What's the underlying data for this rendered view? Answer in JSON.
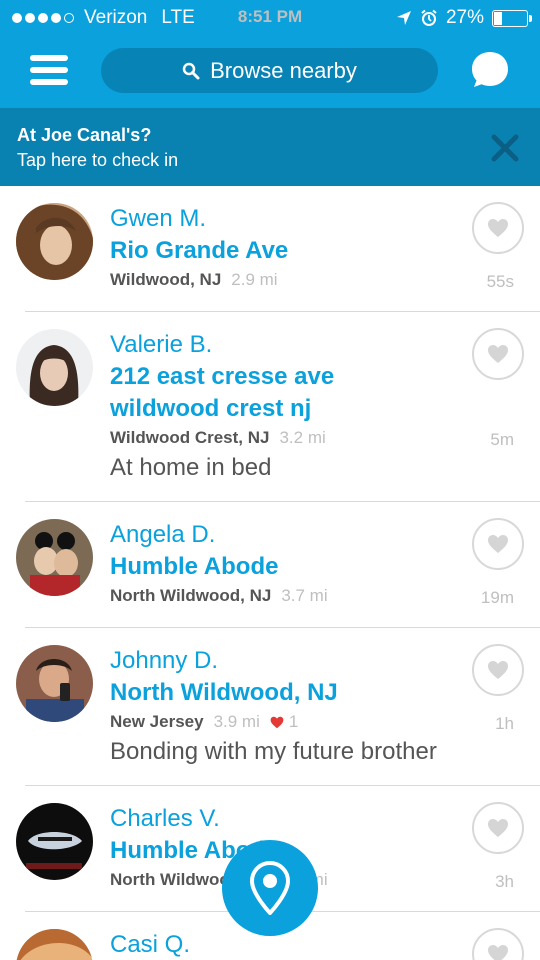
{
  "status_bar": {
    "carrier": "Verizon",
    "network": "LTE",
    "time": "8:51 PM",
    "battery": "27%",
    "battery_level": 0.27
  },
  "header": {
    "search_label": "Browse nearby",
    "icons": [
      "menu-icon",
      "search-icon",
      "chat-icon"
    ]
  },
  "checkin_banner": {
    "title": "At Joe Canal's?",
    "subtitle": "Tap here to check in",
    "close_icon": "close-icon"
  },
  "colors": {
    "accent": "#0aa1dc",
    "banner": "#0a82b1",
    "heart": "#e53935"
  },
  "feed": [
    {
      "name": "Gwen M.",
      "place": [
        "Rio Grande Ave"
      ],
      "city": "Wildwood, NJ",
      "distance": "2.9 mi",
      "time": "55s",
      "status": "",
      "likes": ""
    },
    {
      "name": "Valerie B.",
      "place": [
        "212 east cresse ave",
        "wildwood crest nj"
      ],
      "city": "Wildwood Crest, NJ",
      "distance": "3.2 mi",
      "time": "5m",
      "status": "At home in bed",
      "likes": ""
    },
    {
      "name": "Angela D.",
      "place": [
        "Humble Abode"
      ],
      "city": "North Wildwood, NJ",
      "distance": "3.7 mi",
      "time": "19m",
      "status": "",
      "likes": ""
    },
    {
      "name": "Johnny D.",
      "place": [
        "North Wildwood, NJ"
      ],
      "city": "New Jersey",
      "distance": "3.9 mi",
      "time": "1h",
      "status": "Bonding with my future brother",
      "likes": "1"
    },
    {
      "name": "Charles V.",
      "place": [
        "Humble Abode"
      ],
      "city": "North Wildwood, NJ",
      "distance": "3.7 mi",
      "time": "3h",
      "status": "",
      "likes": ""
    },
    {
      "name": "Casi Q.",
      "place": [],
      "city": "",
      "distance": "",
      "time": "",
      "status": "",
      "likes": ""
    }
  ]
}
